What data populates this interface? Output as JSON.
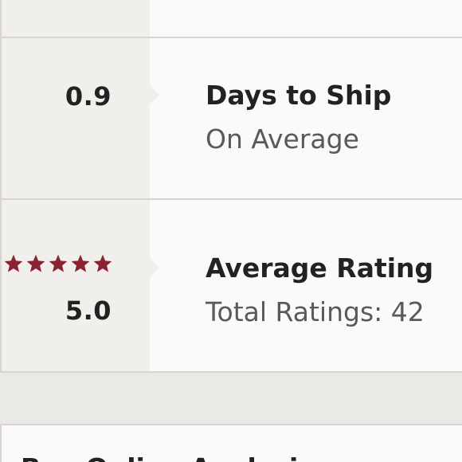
{
  "stats": [
    {
      "value": "0.9",
      "title": "Days to Ship",
      "subtitle": "On Average"
    },
    {
      "value": "5.0",
      "title": "Average Rating",
      "subtitle": "Total Ratings: 42",
      "stars_filled": 5,
      "stars_total": 5
    }
  ],
  "next_section": {
    "title_partial": "Buy Online Analysis"
  },
  "colors": {
    "star": "#8b2231",
    "panel_left": "#f1efec",
    "panel_right": "#fbf9f9",
    "page_bg": "#ebe9e5",
    "text_primary": "#222222",
    "text_secondary": "#595959"
  },
  "icons": {
    "rating_star": "star-icon"
  }
}
